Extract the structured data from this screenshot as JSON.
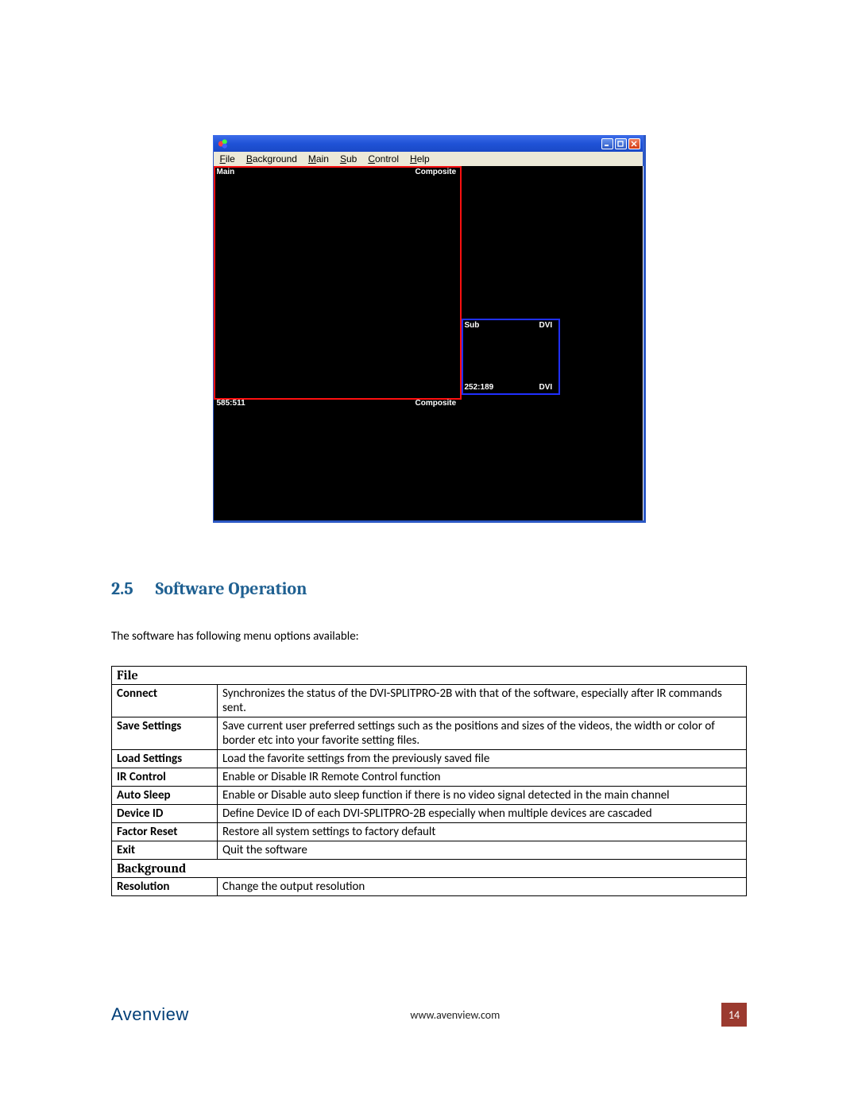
{
  "app_window": {
    "menubar": [
      "File",
      "Background",
      "Main",
      "Sub",
      "Control",
      "Help"
    ],
    "main_region": {
      "top_left_label": "Main",
      "top_right_label": "Composite",
      "bottom_left_label": "585:511",
      "bottom_right_label": "Composite"
    },
    "sub_region": {
      "top_left_label": "Sub",
      "top_right_label": "DVI",
      "bottom_left_label": "252:189",
      "bottom_right_label": "DVI"
    }
  },
  "section": {
    "number": "2.5",
    "title": "Software Operation"
  },
  "intro_text": "The software has following menu options available:",
  "menu_groups": [
    {
      "group": "File",
      "rows": [
        {
          "name": "Connect",
          "desc": "Synchronizes the status of the DVI-SPLITPRO-2B with that of the software, especially after IR commands sent."
        },
        {
          "name": "Save Settings",
          "desc": "Save current user preferred settings such as the positions and sizes of the videos, the width or color of border etc into your favorite setting files."
        },
        {
          "name": "Load Settings",
          "desc": "Load the favorite settings from the previously saved file"
        },
        {
          "name": "IR Control",
          "desc": "Enable or Disable IR Remote Control function"
        },
        {
          "name": "Auto Sleep",
          "desc": "Enable or Disable auto sleep function if there is no video signal detected in the main channel"
        },
        {
          "name": "Device ID",
          "desc": "Define Device ID of each DVI-SPLITPRO-2B especially when multiple devices are cascaded"
        },
        {
          "name": "Factor Reset",
          "desc": "Restore all system settings to factory default"
        },
        {
          "name": "Exit",
          "desc": "Quit the software"
        }
      ]
    },
    {
      "group": "Background",
      "rows": [
        {
          "name": "Resolution",
          "desc": "Change the output resolution"
        }
      ]
    }
  ],
  "footer": {
    "brand": "Avenview",
    "url": "www.avenview.com",
    "page": "14"
  }
}
